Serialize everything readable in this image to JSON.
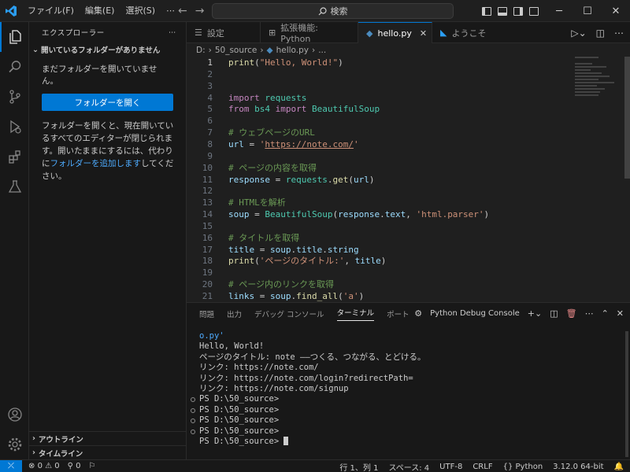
{
  "titlebar": {
    "menu": [
      "ファイル(F)",
      "編集(E)",
      "選択(S)",
      "⋯"
    ],
    "search_placeholder": "検索"
  },
  "sidebar": {
    "title": "エクスプローラー",
    "section_title": "開いているフォルダーがありません",
    "no_folder_message": "まだフォルダーを開いていません。",
    "open_folder_button": "フォルダーを開く",
    "description_1": "フォルダーを開くと、現在開いているすべてのエディターが閉じられます。開いたままにするには、代わりに",
    "description_link": "フォルダーを追加します",
    "description_2": "してください。",
    "outline_label": "アウトライン",
    "timeline_label": "タイムライン"
  },
  "tabs": [
    {
      "label": "設定",
      "icon": "settings-icon"
    },
    {
      "label": "拡張機能: Python",
      "icon": "extensions-icon"
    },
    {
      "label": "hello.py",
      "icon": "python-file-icon",
      "active": true
    },
    {
      "label": "ようこそ",
      "icon": "vscode-icon"
    }
  ],
  "breadcrumb": {
    "drive": "D:",
    "folder": "50_source",
    "file": "hello.py",
    "more": "..."
  },
  "editor": {
    "lines": [
      {
        "n": "1",
        "code": "print(\"Hello, World!\")"
      },
      {
        "n": "2",
        "code": ""
      },
      {
        "n": "3",
        "code": ""
      },
      {
        "n": "4",
        "code": "import requests"
      },
      {
        "n": "5",
        "code": "from bs4 import BeautifulSoup"
      },
      {
        "n": "6",
        "code": ""
      },
      {
        "n": "7",
        "code": "# ウェブページのURL"
      },
      {
        "n": "8",
        "code": "url = 'https://note.com/'"
      },
      {
        "n": "9",
        "code": ""
      },
      {
        "n": "10",
        "code": "# ページの内容を取得"
      },
      {
        "n": "11",
        "code": "response = requests.get(url)"
      },
      {
        "n": "12",
        "code": ""
      },
      {
        "n": "13",
        "code": "# HTMLを解析"
      },
      {
        "n": "14",
        "code": "soup = BeautifulSoup(response.text, 'html.parser')"
      },
      {
        "n": "15",
        "code": ""
      },
      {
        "n": "16",
        "code": "# タイトルを取得"
      },
      {
        "n": "17",
        "code": "title = soup.title.string"
      },
      {
        "n": "18",
        "code": "print('ページのタイトル:', title)"
      },
      {
        "n": "19",
        "code": ""
      },
      {
        "n": "20",
        "code": "# ページ内のリンクを取得"
      },
      {
        "n": "21",
        "code": "links = soup.find_all('a')"
      }
    ]
  },
  "panel": {
    "tabs": [
      "問題",
      "出力",
      "デバッグ コンソール",
      "ターミナル",
      "ポート"
    ],
    "active_tab": "ターミナル",
    "terminal_name": "Python Debug Console",
    "terminal_lines": [
      {
        "text": "o.py'",
        "type": "cont"
      },
      {
        "text": "Hello, World!",
        "type": "out"
      },
      {
        "text": "ページのタイトル: note ――つくる、つながる、とどける。",
        "type": "out"
      },
      {
        "text": "リンク: https://note.com/",
        "type": "out"
      },
      {
        "text": "リンク: https://note.com/login?redirectPath=",
        "type": "out"
      },
      {
        "text": "リンク: https://note.com/signup",
        "type": "out"
      },
      {
        "text": "PS D:\\50_source>",
        "type": "prompt"
      },
      {
        "text": "PS D:\\50_source>",
        "type": "prompt"
      },
      {
        "text": "PS D:\\50_source>",
        "type": "prompt"
      },
      {
        "text": "PS D:\\50_source>",
        "type": "prompt"
      },
      {
        "text": "PS D:\\50_source>",
        "type": "current"
      }
    ]
  },
  "statusbar": {
    "errors": "0",
    "warnings": "0",
    "ports": "0",
    "position": "行 1、列 1",
    "spaces": "スペース: 4",
    "encoding": "UTF-8",
    "eol": "CRLF",
    "language": "Python",
    "interpreter": "3.12.0 64-bit"
  },
  "colors": {
    "accent": "#0078d4",
    "background": "#1f1f1f",
    "sidebar": "#181818"
  }
}
